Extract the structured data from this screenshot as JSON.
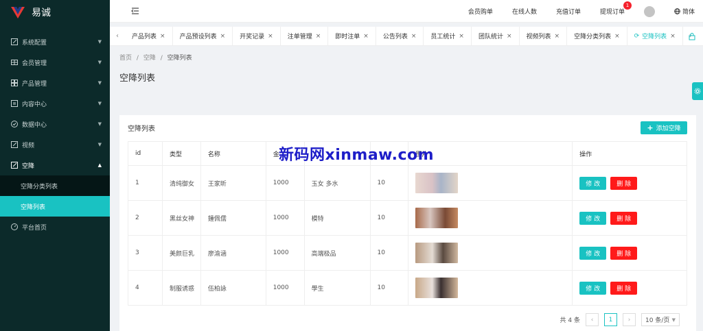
{
  "app": {
    "name": "易诚"
  },
  "sidebar": {
    "items": [
      {
        "label": "系统配置",
        "icon": "edit-icon"
      },
      {
        "label": "会员管理",
        "icon": "table-icon"
      },
      {
        "label": "产品管理",
        "icon": "grid-icon"
      },
      {
        "label": "内容中心",
        "icon": "document-icon"
      },
      {
        "label": "数据中心",
        "icon": "check-circle-icon"
      },
      {
        "label": "视频",
        "icon": "edit-icon"
      },
      {
        "label": "空降",
        "icon": "edit-icon"
      }
    ],
    "submenu": [
      {
        "label": "空降分类列表"
      },
      {
        "label": "空降列表"
      }
    ],
    "home": {
      "label": "平台首页"
    }
  },
  "topbar": {
    "links": [
      "会员购单",
      "在线人数",
      "充值订单",
      "提现订单"
    ],
    "withdraw_badge": "1",
    "lang": "简体"
  },
  "tabs": [
    "产品列表",
    "产品预设列表",
    "开奖记录",
    "注单管理",
    "即时注单",
    "公告列表",
    "员工统计",
    "团队统计",
    "视频列表",
    "空降分类列表",
    "空降列表"
  ],
  "breadcrumb": [
    "首页",
    "/",
    "空降",
    "/",
    "空降列表"
  ],
  "page_title": "空降列表",
  "card": {
    "title": "空降列表",
    "add_button": "添加空降"
  },
  "table": {
    "headers": [
      "id",
      "类型",
      "名称",
      "金",
      "",
      "",
      "图片",
      "操作"
    ],
    "rows": [
      {
        "id": "1",
        "type": "清纯御女",
        "name": "王家昕",
        "amount": "1000",
        "tags": "玉女 多水",
        "count": "10"
      },
      {
        "id": "2",
        "type": "黑丝女神",
        "name": "鍾佩儒",
        "amount": "1000",
        "tags": "模特",
        "count": "10"
      },
      {
        "id": "3",
        "type": "美颜巨乳",
        "name": "廖渝涵",
        "amount": "1000",
        "tags": "高端极品",
        "count": "10"
      },
      {
        "id": "4",
        "type": "制服诱惑",
        "name": "伍柏詠",
        "amount": "1000",
        "tags": "學生",
        "count": "10"
      }
    ],
    "edit_label": "修 改",
    "delete_label": "删 除"
  },
  "pagination": {
    "total": "共 4 条",
    "current_page": "1",
    "page_size": "10 条/页"
  },
  "watermark": "新码网xinmaw.com",
  "colors": {
    "accent": "#19c2c2",
    "danger": "#ff1a1a",
    "sidebar": "#0c2a2a"
  }
}
